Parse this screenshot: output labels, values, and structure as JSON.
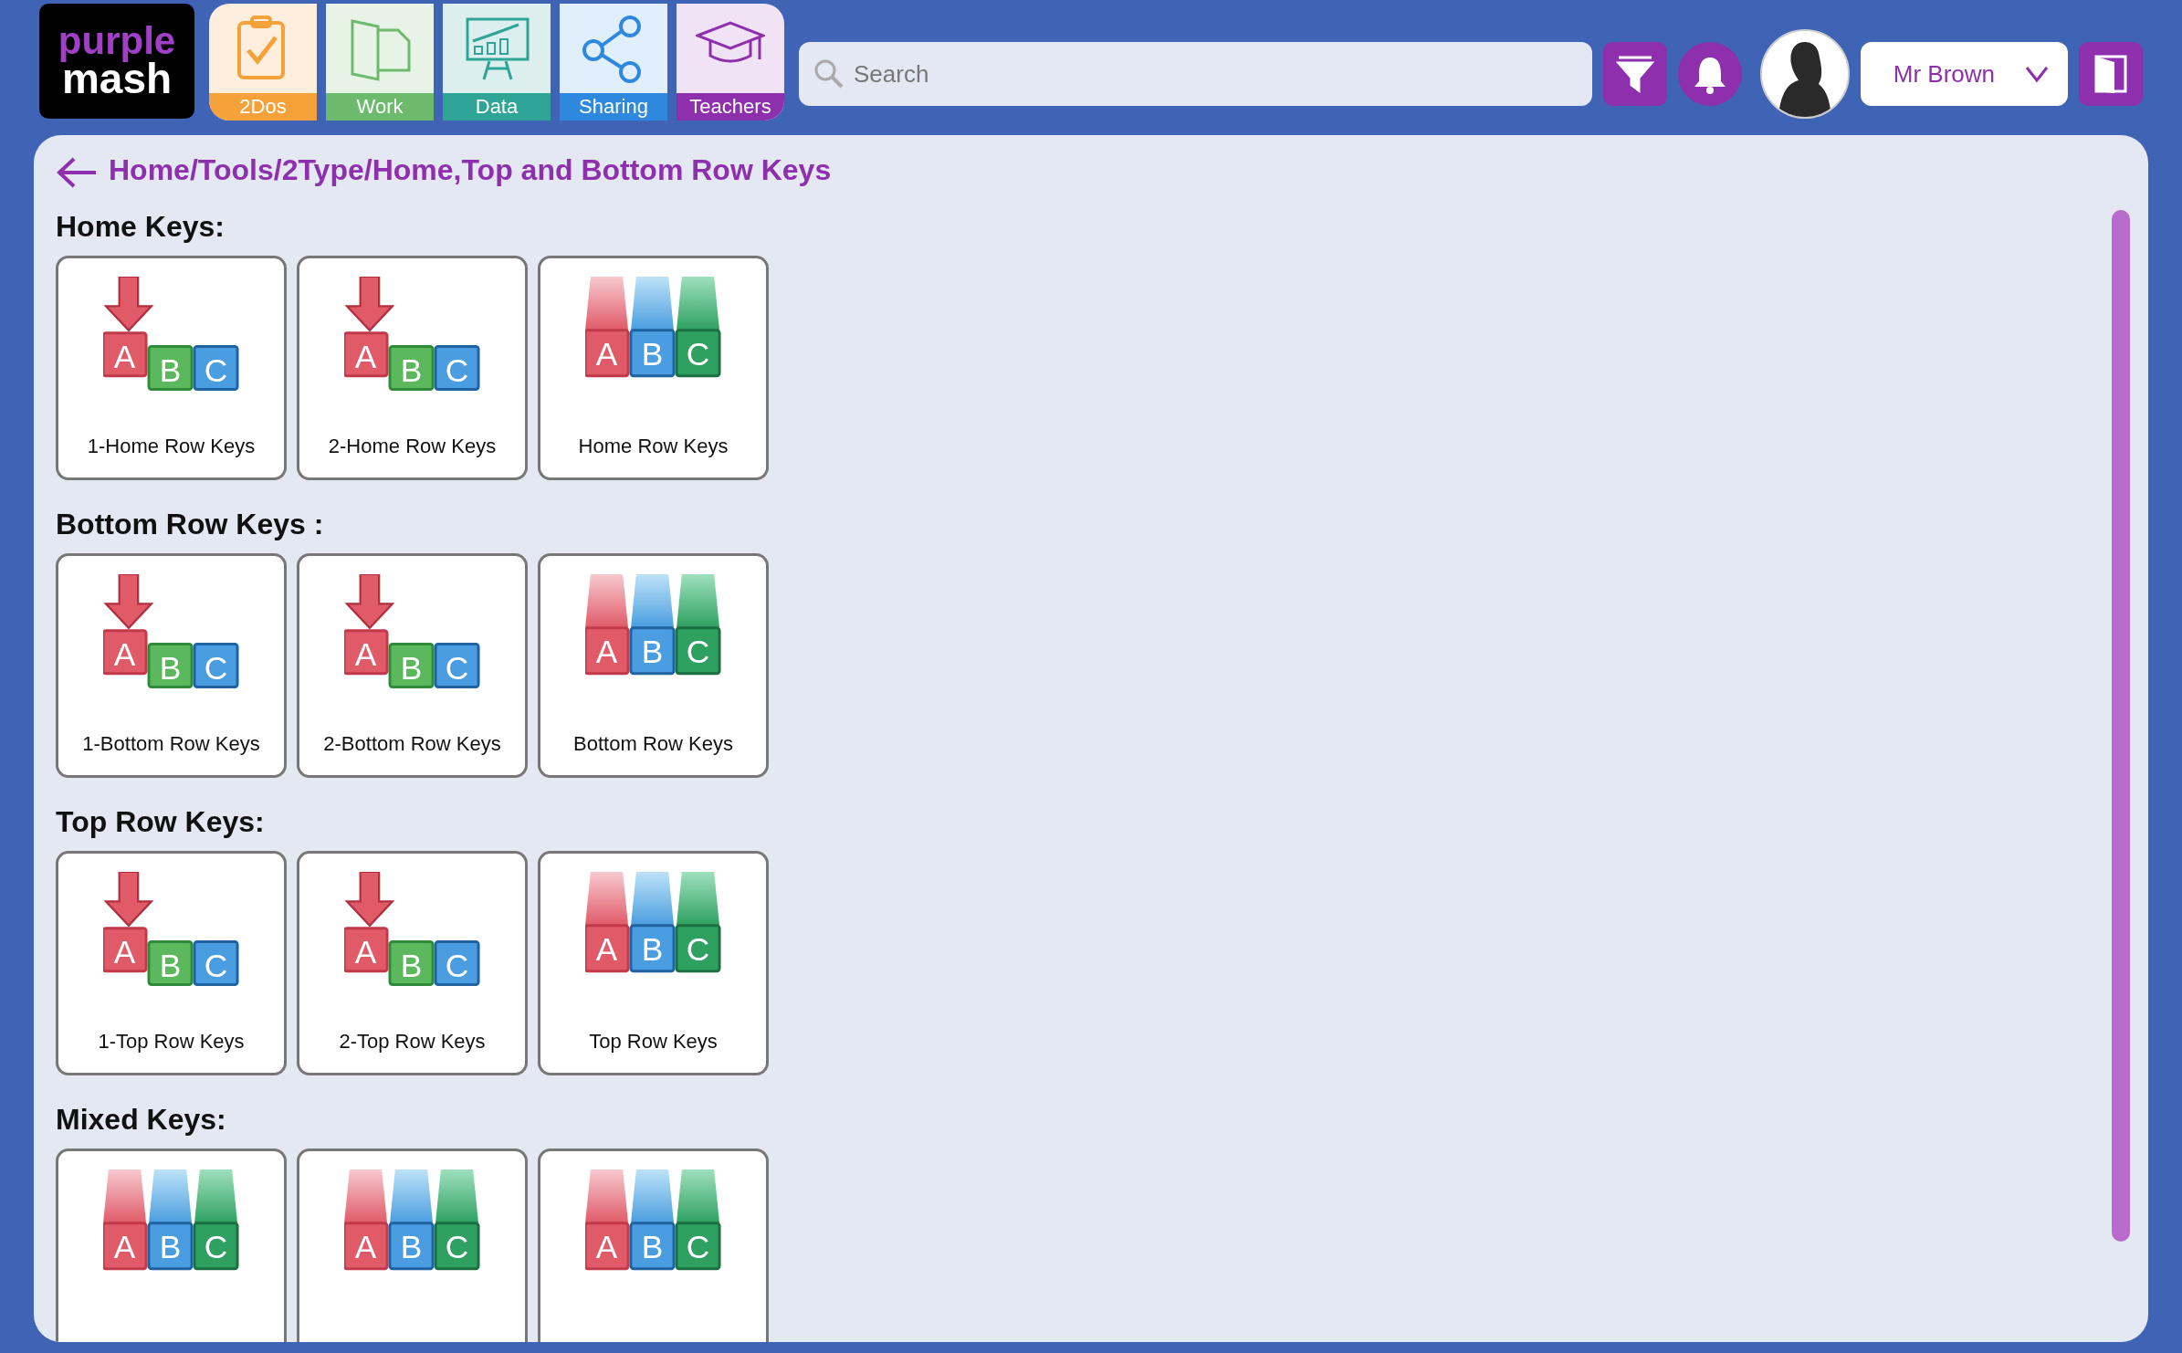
{
  "logo": {
    "line_1": "purple",
    "line_2": "mash"
  },
  "nav_tabs": [
    {
      "label": "2Dos",
      "kind": "todos",
      "color": "#f6a23a"
    },
    {
      "label": "Work",
      "kind": "work",
      "color": "#6cbb6c"
    },
    {
      "label": "Data",
      "kind": "data",
      "color": "#2ea597"
    },
    {
      "label": "Sharing",
      "kind": "sharing",
      "color": "#2e88dd"
    },
    {
      "label": "Teachers",
      "kind": "teachers",
      "color": "#8e2fae"
    }
  ],
  "search": {
    "placeholder": "Search"
  },
  "user": {
    "name": "Mr Brown"
  },
  "breadcrumb": "Home/Tools/2Type/Home,Top and Bottom Row Keys",
  "sections": [
    {
      "heading": "Home Keys:",
      "tiles": [
        {
          "label": "1-Home Row Keys",
          "kind": "arrow",
          "blocks": [
            "A",
            "B",
            "C"
          ]
        },
        {
          "label": "2-Home Row Keys",
          "kind": "arrow",
          "blocks": [
            "A",
            "B",
            "C"
          ]
        },
        {
          "label": "Home Row Keys",
          "kind": "stack",
          "blocks": [
            "A",
            "B",
            "C"
          ]
        }
      ]
    },
    {
      "heading": "Bottom Row Keys :",
      "tiles": [
        {
          "label": "1-Bottom Row Keys",
          "kind": "arrow",
          "blocks": [
            "A",
            "B",
            "C"
          ]
        },
        {
          "label": "2-Bottom Row Keys",
          "kind": "arrow",
          "blocks": [
            "A",
            "B",
            "C"
          ]
        },
        {
          "label": "Bottom Row Keys",
          "kind": "stack",
          "blocks": [
            "A",
            "B",
            "C"
          ]
        }
      ]
    },
    {
      "heading": "Top Row Keys:",
      "tiles": [
        {
          "label": "1-Top Row Keys",
          "kind": "arrow",
          "blocks": [
            "A",
            "B",
            "C"
          ]
        },
        {
          "label": "2-Top Row Keys",
          "kind": "arrow",
          "blocks": [
            "A",
            "B",
            "C"
          ]
        },
        {
          "label": "Top Row Keys",
          "kind": "stack",
          "blocks": [
            "A",
            "B",
            "C"
          ]
        }
      ]
    },
    {
      "heading": "Mixed Keys:",
      "tiles": [
        {
          "kind": "stack",
          "blocks": [
            "A",
            "B",
            "C"
          ]
        },
        {
          "kind": "stack",
          "blocks": [
            "A",
            "B",
            "C"
          ]
        },
        {
          "kind": "stack",
          "blocks": [
            "A",
            "B",
            "C"
          ]
        }
      ]
    }
  ]
}
